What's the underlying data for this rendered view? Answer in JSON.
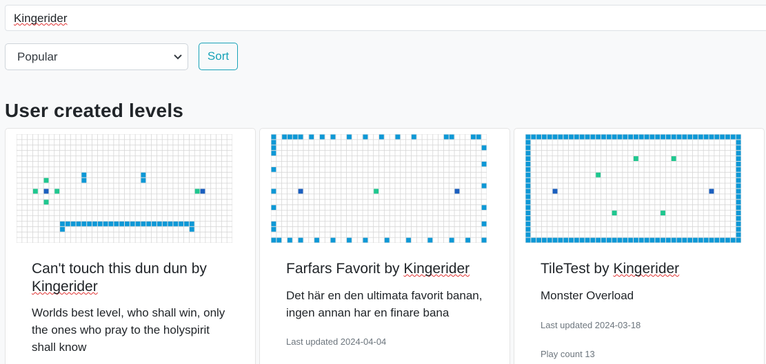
{
  "search": {
    "value": "Kingerider",
    "placeholder": ""
  },
  "sort": {
    "selected": "Popular",
    "button_label": "Sort"
  },
  "section_title": "User created levels",
  "colors": {
    "wall": "#0d98d6",
    "pickup": "#1fc78f",
    "player": "#1a5fbf",
    "grid": "#d6d6d6",
    "accent": "#17a2b8"
  },
  "levels": [
    {
      "name": "Can't touch this dun dun",
      "by": "by",
      "author": "Kingerider",
      "description": "Worlds best level, who shall win, only the ones who pray to the holyspirit shall know",
      "last_updated": "",
      "play_count": ""
    },
    {
      "name": "Farfars Favorit",
      "by": "by",
      "author": "Kingerider",
      "description": "Det här en den ultimata favorit banan, ingen annan har en finare bana",
      "last_updated": "Last updated 2024-04-04",
      "play_count": ""
    },
    {
      "name": "TileTest",
      "by": "by",
      "author": "Kingerider",
      "description": "Monster Overload",
      "last_updated": "Last updated 2024-03-18",
      "play_count": "Play count 13"
    }
  ]
}
